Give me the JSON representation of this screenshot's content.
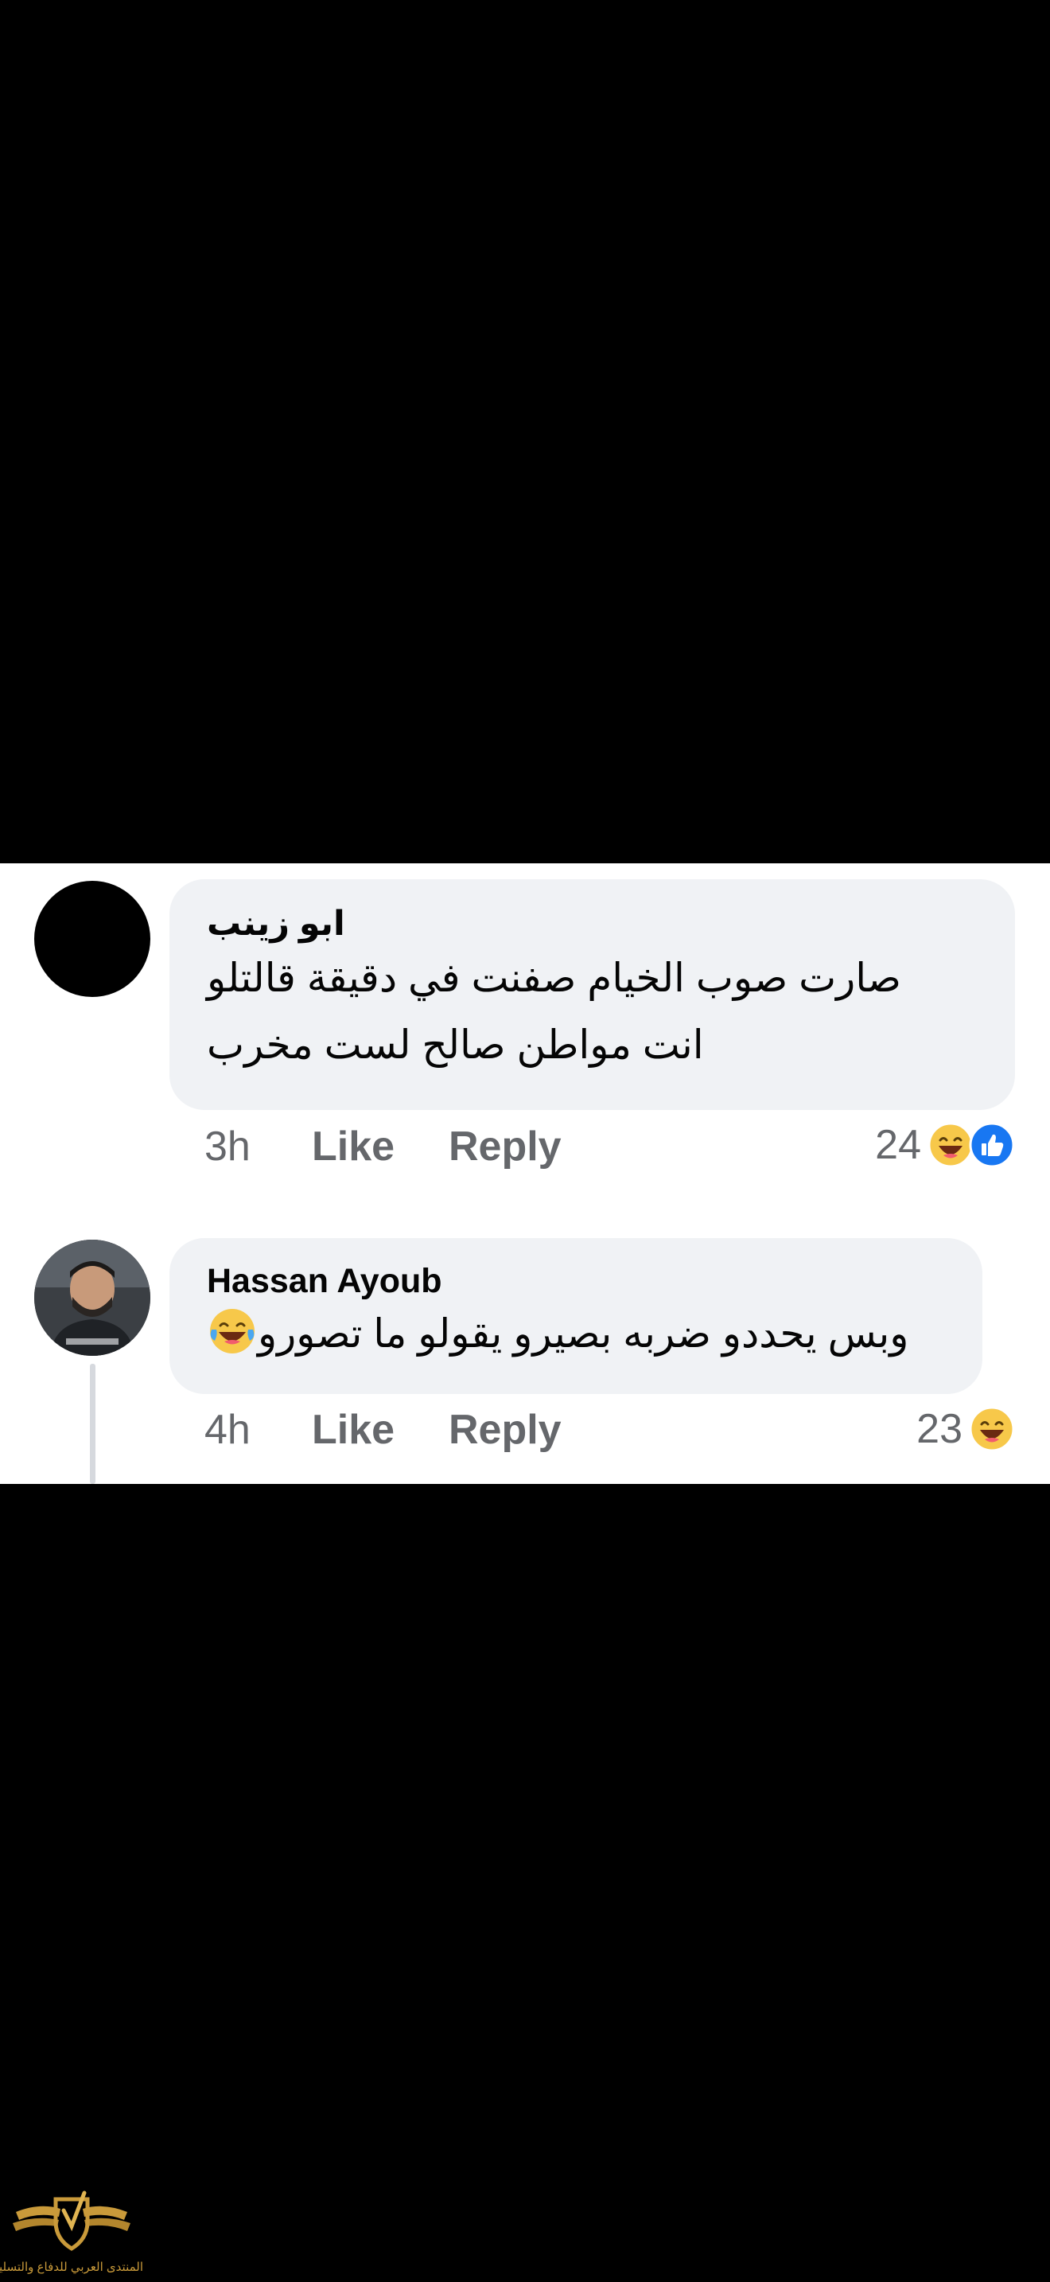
{
  "comments": [
    {
      "author": "ابو زينب",
      "lines": [
        "صارت صوب الخيام صفنت في دقيقة قالتلو",
        "انت مواطن صالح لست مخرب"
      ],
      "time": "3h",
      "like_label": "Like",
      "reply_label": "Reply",
      "reaction_count": "24",
      "reactions": [
        "haha-icon",
        "like-icon"
      ]
    },
    {
      "author": "Hassan Ayoub",
      "text": "وبس يحددو ضربه بصيرو يقولو ما تصورو",
      "text_emoji": "tears-of-joy-icon",
      "time": "4h",
      "like_label": "Like",
      "reply_label": "Reply",
      "reaction_count": "23",
      "reactions": [
        "haha-icon"
      ]
    }
  ],
  "watermark": {
    "text": "المنتدى العربي للدفاع والتسليح"
  },
  "colors": {
    "bubble": "#f0f2f5",
    "meta_text": "#65676b",
    "name_text": "#050505",
    "like_blue": "#1877f2",
    "haha_yellow": "#f7c84a",
    "watermark_gold": "#c99a3a"
  }
}
